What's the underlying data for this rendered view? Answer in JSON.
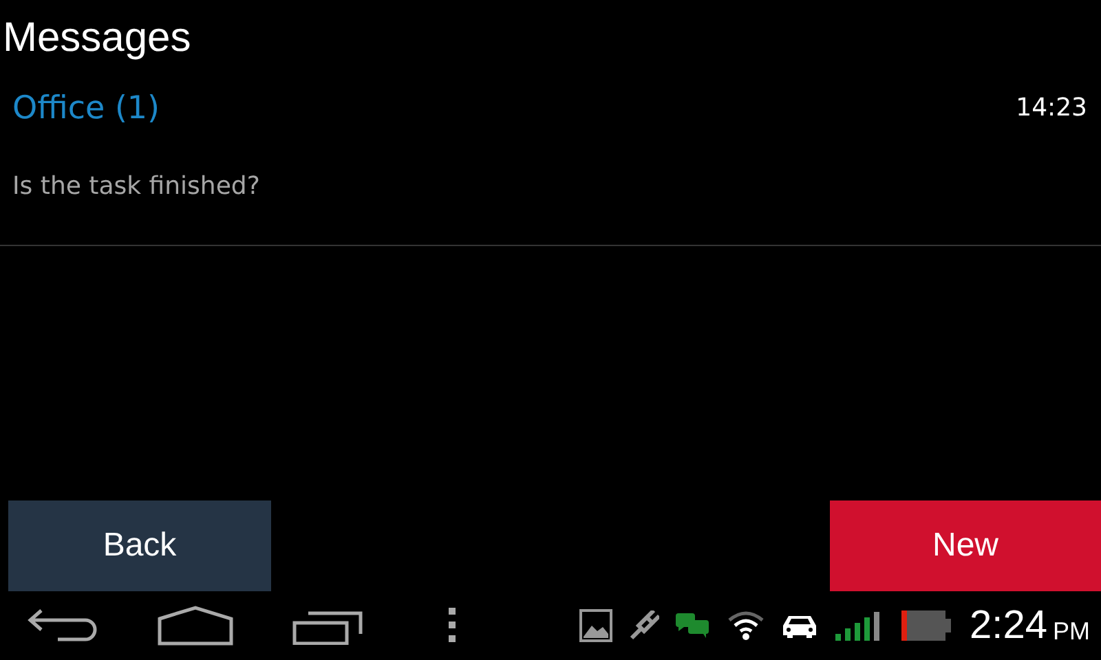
{
  "title": "Messages",
  "conversations": [
    {
      "name": "Office (1)",
      "preview": "Is the task finished?",
      "time": "14:23"
    }
  ],
  "buttons": [
    {
      "label": "Back",
      "kind": "secondary"
    },
    {
      "label": "New",
      "kind": "primary"
    }
  ],
  "status_bar": {
    "time": "2:24",
    "ampm": "PM"
  }
}
